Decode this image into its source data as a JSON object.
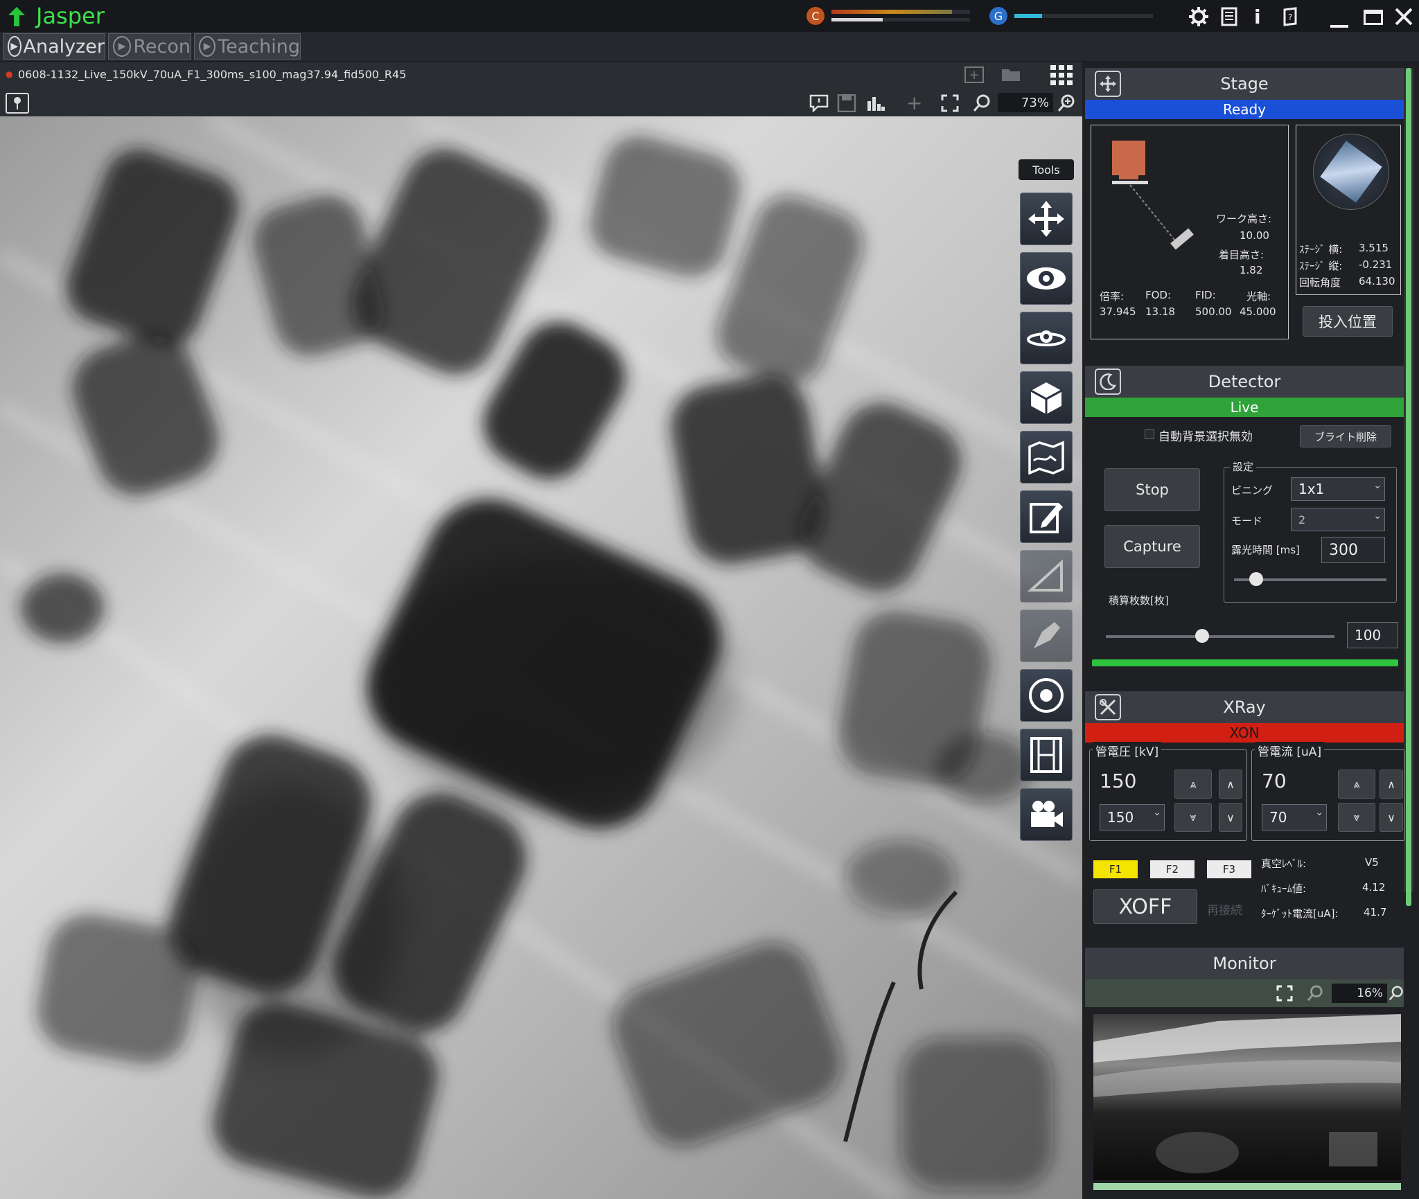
{
  "app": {
    "title": "Jasper"
  },
  "title_status": {
    "c_label": "C",
    "g_label": "G",
    "c_progress": 0.37,
    "g_progress": 0.2
  },
  "tabs": [
    {
      "label": "Analyzer"
    },
    {
      "label": "Recon"
    },
    {
      "label": "Teaching"
    }
  ],
  "file": {
    "name": "0608-1132_Live_150kV_70uA_F1_300ms_s100_mag37.94_fid500_R45"
  },
  "viewer": {
    "zoom": "73%",
    "tools_label": "Tools"
  },
  "stage": {
    "title": "Stage",
    "status": "Ready",
    "work_height_label": "ワーク高さ:",
    "work_height": "10.00",
    "focus_height_label": "着目高さ:",
    "focus_height": "1.82",
    "mag_label": "倍率:",
    "mag": "37.945",
    "fod_label": "FOD:",
    "fod": "13.18",
    "fid_label": "FID:",
    "fid": "500.00",
    "axis_label": "光軸:",
    "axis": "45.000",
    "stage_x_label": "ｽﾃｰｼﾞ 横:",
    "stage_x": "3.515",
    "stage_y_label": "ｽﾃｰｼﾞ 縦:",
    "stage_y": "-0.231",
    "rot_label": "回転角度",
    "rot": "64.130",
    "load_button": "投入位置"
  },
  "detector": {
    "title": "Detector",
    "status": "Live",
    "auto_bg_label": "自動背景選択無効",
    "bright_button": "ブライト削除",
    "settings_label": "設定",
    "binning_label": "ビニング",
    "binning": "1x1",
    "mode_label": "モード",
    "mode": "2",
    "exposure_label": "露光時間 [ms]",
    "exposure": "300",
    "stop_button": "Stop",
    "capture_button": "Capture",
    "accum_label": "積算枚数[枚]",
    "accum": "100",
    "exposure_slider": 0.1,
    "accum_slider": 0.39
  },
  "xray": {
    "title": "XRay",
    "status": "XON",
    "kv_label": "管電圧 [kV]",
    "kv": "150",
    "kv_set": "150",
    "ua_label": "管電流 [uA]",
    "ua": "70",
    "ua_set": "70",
    "f1": "F1",
    "f2": "F2",
    "f3": "F3",
    "xoff_button": "XOFF",
    "reconnect": "再接続",
    "vac_label": "真空ﾚﾍﾞﾙ:",
    "vac": "V5",
    "vol_label": "ﾊﾞｷｭｰﾑ値:",
    "vol": "4.12",
    "target_label": "ﾀｰｹﾞｯﾄ電流[uA]:",
    "target": "41.7"
  },
  "monitor": {
    "title": "Monitor",
    "zoom": "16%"
  },
  "colors": {
    "accent_green": "#3ce04a",
    "ready_blue": "#1a4fd8",
    "live_green": "#2fa339",
    "xon_red": "#d21f14",
    "f1_yellow": "#f5e400"
  }
}
